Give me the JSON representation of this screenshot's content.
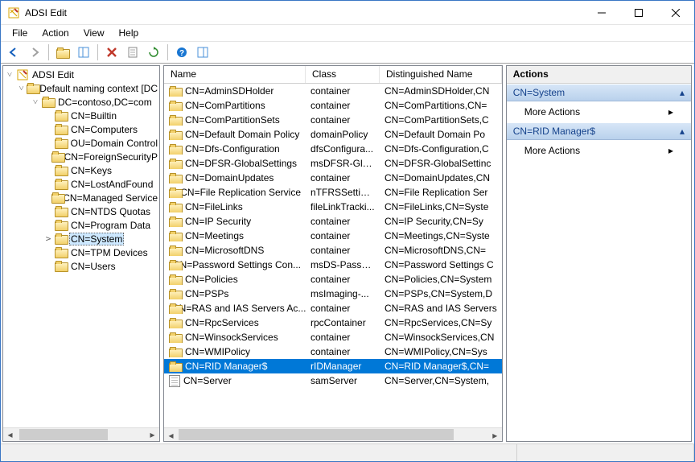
{
  "window": {
    "title": "ADSI Edit"
  },
  "menu": {
    "file": "File",
    "action": "Action",
    "view": "View",
    "help": "Help"
  },
  "tree": {
    "root": "ADSI Edit",
    "context": "Default naming context [DC",
    "domain": "DC=contoso,DC=com",
    "nodes": [
      "CN=Builtin",
      "CN=Computers",
      "OU=Domain Control",
      "CN=ForeignSecurityP",
      "CN=Keys",
      "CN=LostAndFound",
      "CN=Managed Service",
      "CN=NTDS Quotas",
      "CN=Program Data",
      "CN=System",
      "CN=TPM Devices",
      "CN=Users"
    ],
    "selected": "CN=System"
  },
  "list": {
    "columns": {
      "name": "Name",
      "class": "Class",
      "dn": "Distinguished Name"
    },
    "rows": [
      {
        "name": "CN=AdminSDHolder",
        "class": "container",
        "dn": "CN=AdminSDHolder,CN",
        "icon": "folder"
      },
      {
        "name": "CN=ComPartitions",
        "class": "container",
        "dn": "CN=ComPartitions,CN=",
        "icon": "folder"
      },
      {
        "name": "CN=ComPartitionSets",
        "class": "container",
        "dn": "CN=ComPartitionSets,C",
        "icon": "folder"
      },
      {
        "name": "CN=Default Domain Policy",
        "class": "domainPolicy",
        "dn": "CN=Default Domain Po",
        "icon": "folder"
      },
      {
        "name": "CN=Dfs-Configuration",
        "class": "dfsConfigura...",
        "dn": "CN=Dfs-Configuration,C",
        "icon": "folder"
      },
      {
        "name": "CN=DFSR-GlobalSettings",
        "class": "msDFSR-Glo...",
        "dn": "CN=DFSR-GlobalSettinc",
        "icon": "folder"
      },
      {
        "name": "CN=DomainUpdates",
        "class": "container",
        "dn": "CN=DomainUpdates,CN",
        "icon": "folder"
      },
      {
        "name": "CN=File Replication Service",
        "class": "nTFRSSettings",
        "dn": "CN=File Replication Ser",
        "icon": "folder"
      },
      {
        "name": "CN=FileLinks",
        "class": "fileLinkTracki...",
        "dn": "CN=FileLinks,CN=Syste",
        "icon": "folder"
      },
      {
        "name": "CN=IP Security",
        "class": "container",
        "dn": "CN=IP Security,CN=Sy",
        "icon": "folder"
      },
      {
        "name": "CN=Meetings",
        "class": "container",
        "dn": "CN=Meetings,CN=Syste",
        "icon": "folder"
      },
      {
        "name": "CN=MicrosoftDNS",
        "class": "container",
        "dn": "CN=MicrosoftDNS,CN=",
        "icon": "folder"
      },
      {
        "name": "CN=Password Settings Con...",
        "class": "msDS-Passw...",
        "dn": "CN=Password Settings C",
        "icon": "folder"
      },
      {
        "name": "CN=Policies",
        "class": "container",
        "dn": "CN=Policies,CN=System",
        "icon": "folder"
      },
      {
        "name": "CN=PSPs",
        "class": "msImaging-...",
        "dn": "CN=PSPs,CN=System,D",
        "icon": "folder"
      },
      {
        "name": "CN=RAS and IAS Servers Ac...",
        "class": "container",
        "dn": "CN=RAS and IAS Servers",
        "icon": "folder"
      },
      {
        "name": "CN=RpcServices",
        "class": "rpcContainer",
        "dn": "CN=RpcServices,CN=Sy",
        "icon": "folder"
      },
      {
        "name": "CN=WinsockServices",
        "class": "container",
        "dn": "CN=WinsockServices,CN",
        "icon": "folder"
      },
      {
        "name": "CN=WMIPolicy",
        "class": "container",
        "dn": "CN=WMIPolicy,CN=Sys",
        "icon": "folder"
      },
      {
        "name": "CN=RID Manager$",
        "class": "rIDManager",
        "dn": "CN=RID Manager$,CN=",
        "icon": "folder",
        "selected": true
      },
      {
        "name": "CN=Server",
        "class": "samServer",
        "dn": "CN=Server,CN=System,",
        "icon": "doc"
      }
    ]
  },
  "actions": {
    "header": "Actions",
    "sections": [
      {
        "title": "CN=System",
        "items": [
          "More Actions"
        ]
      },
      {
        "title": "CN=RID Manager$",
        "items": [
          "More Actions"
        ]
      }
    ]
  }
}
